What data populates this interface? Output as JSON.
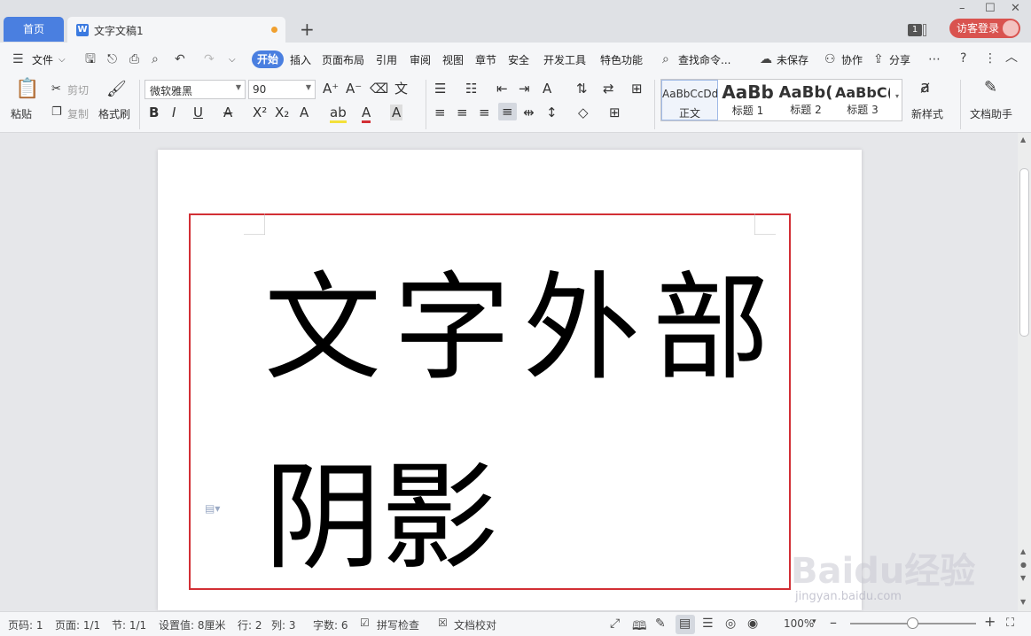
{
  "tabs": {
    "home": "首页",
    "doc": "文字文稿1"
  },
  "topbar": {
    "badge": "1",
    "login": "访客登录"
  },
  "menu": {
    "file": "文件",
    "items": [
      "开始",
      "插入",
      "页面布局",
      "引用",
      "审阅",
      "视图",
      "章节",
      "安全",
      "开发工具",
      "特色功能"
    ],
    "search": "查找命令...",
    "unsaved": "未保存",
    "collab": "协作",
    "share": "分享"
  },
  "ribbon": {
    "paste": "粘贴",
    "cut": "剪切",
    "copy": "复制",
    "format_painter": "格式刷",
    "font": "微软雅黑",
    "size": "90",
    "styles": [
      {
        "preview": "AaBbCcDd",
        "name": "正文"
      },
      {
        "preview": "AaBb",
        "name": "标题 1"
      },
      {
        "preview": "AaBb(",
        "name": "标题 2"
      },
      {
        "preview": "AaBbC(",
        "name": "标题 3"
      }
    ],
    "new_style": "新样式",
    "doc_helper": "文档助手"
  },
  "document": {
    "line1": "文字外部",
    "line2": "阴影"
  },
  "status": {
    "page_no": "页码: 1",
    "pages": "页面: 1/1",
    "section": "节: 1/1",
    "setting": "设置值: 8厘米",
    "row": "行: 2",
    "col": "列: 3",
    "words": "字数: 6",
    "spell": "拼写检查",
    "proof": "文档校对",
    "zoom": "100%"
  },
  "watermark": {
    "brand": "Baidu经验",
    "url": "jingyan.baidu.com"
  },
  "colors": {
    "accent": "#4a7fe0",
    "frame": "#d22f35",
    "login": "#d9534f"
  }
}
